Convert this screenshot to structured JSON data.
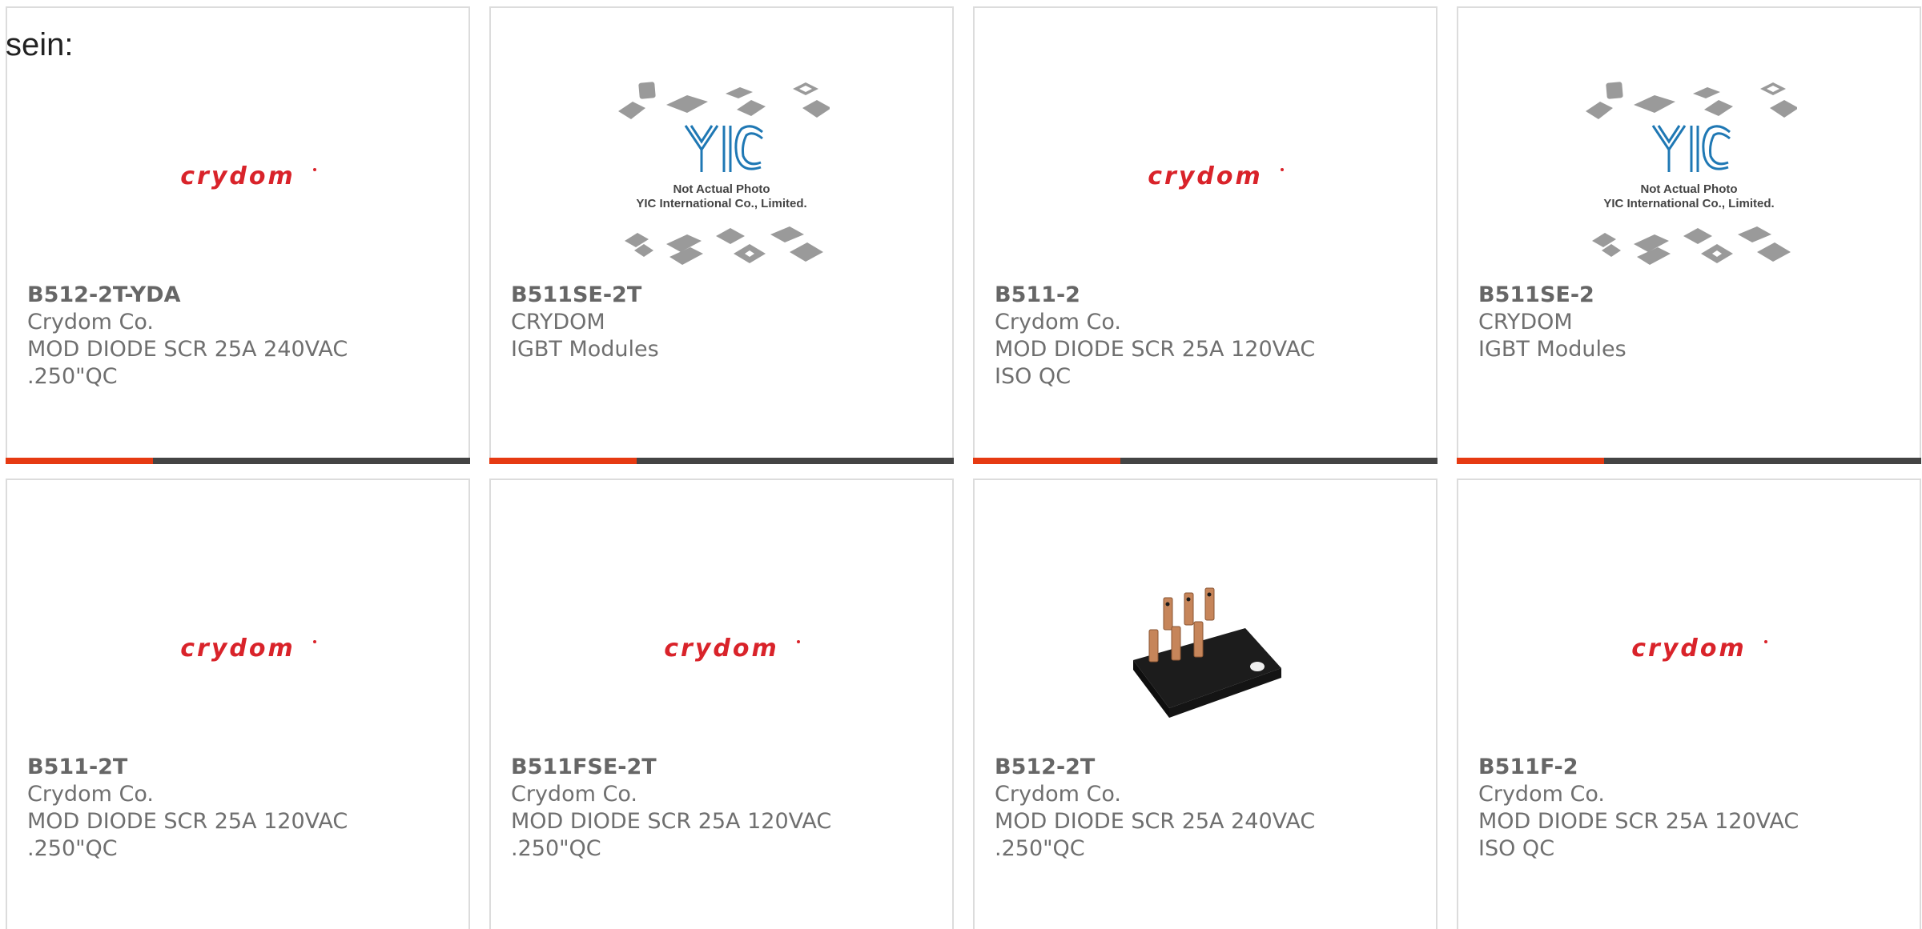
{
  "intro": {
    "text": "sein:"
  },
  "brand_colors": {
    "accent": "#e63a12",
    "bar": "#444444",
    "crydom_red": "#d9232a",
    "yic_blue": "#1f78b4"
  },
  "logos": {
    "crydom_text": "crydom",
    "yic_mark": "YIC",
    "yic_caption_1": "Not Actual Photo",
    "yic_caption_2": "YIC International Co., Limited."
  },
  "products": [
    {
      "part_no": "B512-2T-YDA",
      "manufacturer": "Crydom Co.",
      "desc1": "MOD DIODE SCR 25A 240VAC",
      "desc2": ".250\"QC",
      "image": "crydom-logo"
    },
    {
      "part_no": "B511SE-2T",
      "manufacturer": "CRYDOM",
      "desc1": "IGBT Modules",
      "desc2": "",
      "image": "yic-placeholder"
    },
    {
      "part_no": "B511-2",
      "manufacturer": "Crydom Co.",
      "desc1": "MOD DIODE SCR 25A 120VAC",
      "desc2": "ISO QC",
      "image": "crydom-logo"
    },
    {
      "part_no": "B511SE-2",
      "manufacturer": "CRYDOM",
      "desc1": "IGBT Modules",
      "desc2": "",
      "image": "yic-placeholder"
    },
    {
      "part_no": "B511-2T",
      "manufacturer": "Crydom Co.",
      "desc1": "MOD DIODE SCR 25A 120VAC",
      "desc2": ".250\"QC",
      "image": "crydom-logo"
    },
    {
      "part_no": "B511FSE-2T",
      "manufacturer": "Crydom Co.",
      "desc1": "MOD DIODE SCR 25A 120VAC",
      "desc2": ".250\"QC",
      "image": "crydom-logo"
    },
    {
      "part_no": "B512-2T",
      "manufacturer": "Crydom Co.",
      "desc1": "MOD DIODE SCR 25A 240VAC",
      "desc2": ".250\"QC",
      "image": "relay-photo"
    },
    {
      "part_no": "B511F-2",
      "manufacturer": "Crydom Co.",
      "desc1": "MOD DIODE SCR 25A 120VAC",
      "desc2": "ISO QC",
      "image": "crydom-logo"
    }
  ]
}
